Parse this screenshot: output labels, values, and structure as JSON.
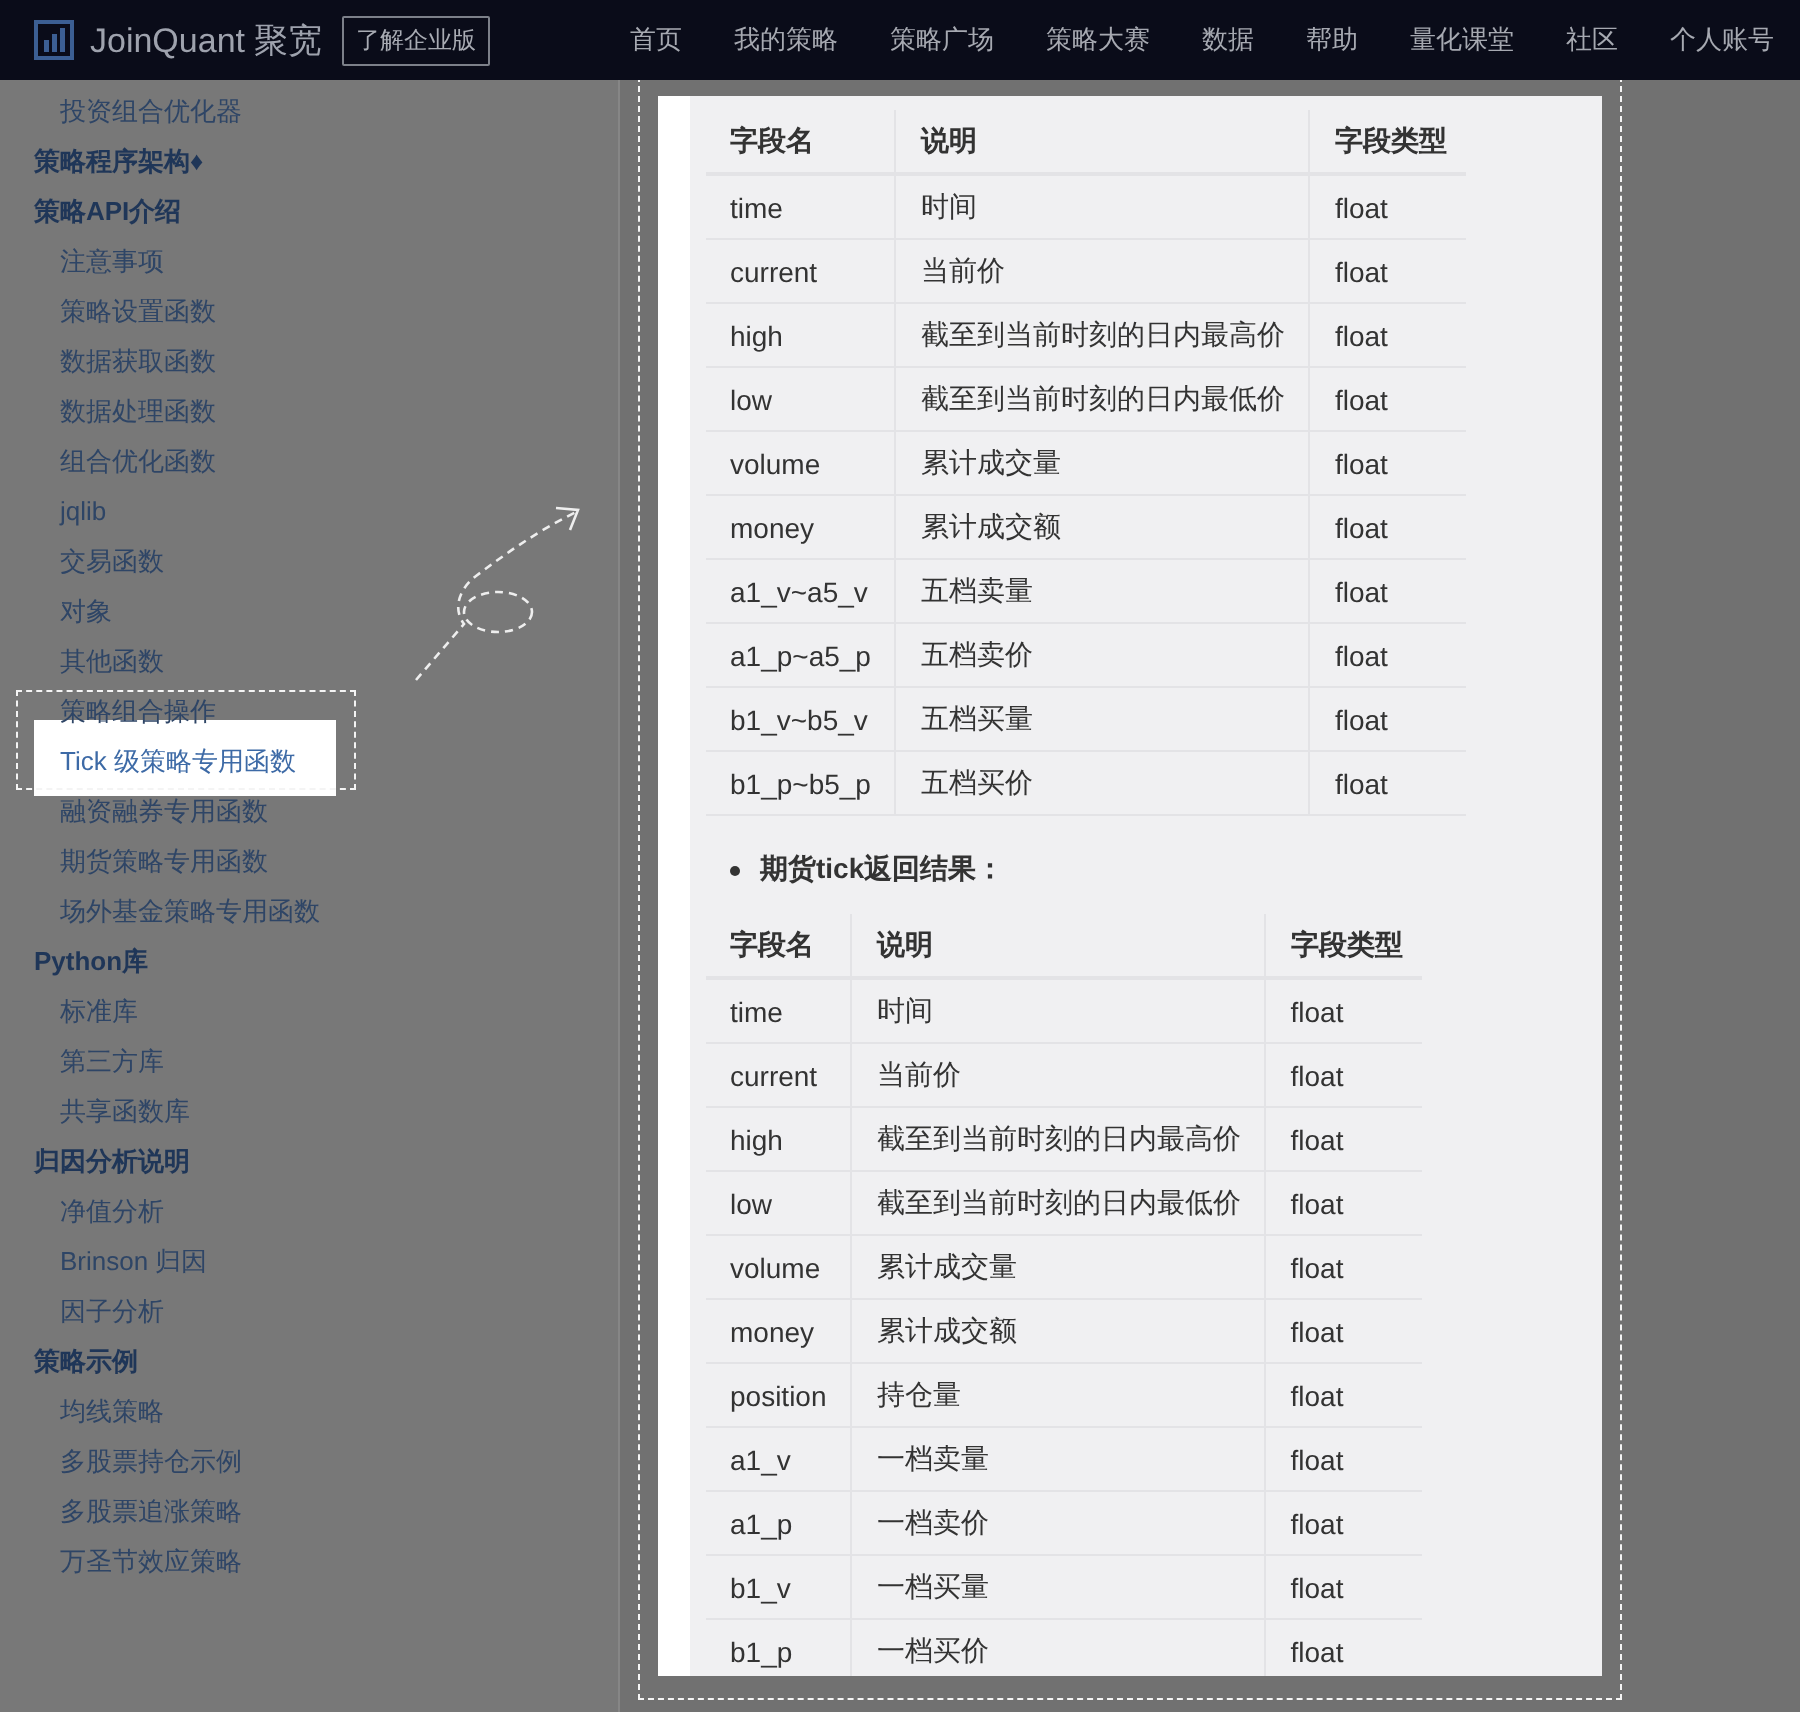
{
  "header": {
    "brand": "JoinQuant 聚宽",
    "enterprise_button": "了解企业版",
    "nav": [
      "首页",
      "我的策略",
      "策略广场",
      "策略大赛",
      "数据",
      "帮助",
      "量化课堂",
      "社区",
      "个人账号"
    ]
  },
  "sidebar": {
    "sections": [
      {
        "children": [
          {
            "label": "投资组合优化器",
            "selected": false
          }
        ]
      },
      {
        "title": "策略程序架构♦"
      },
      {
        "title": "策略API介绍",
        "children": [
          {
            "label": "注意事项",
            "selected": false
          },
          {
            "label": "策略设置函数",
            "selected": false
          },
          {
            "label": "数据获取函数",
            "selected": false
          },
          {
            "label": "数据处理函数",
            "selected": false
          },
          {
            "label": "组合优化函数",
            "selected": false
          },
          {
            "label": "jqlib",
            "selected": false
          },
          {
            "label": "交易函数",
            "selected": false
          },
          {
            "label": "对象",
            "selected": false
          },
          {
            "label": "其他函数",
            "selected": false
          },
          {
            "label": "策略组合操作",
            "selected": false
          },
          {
            "label": "Tick 级策略专用函数",
            "selected": true
          },
          {
            "label": "融资融券专用函数",
            "selected": false
          },
          {
            "label": "期货策略专用函数",
            "selected": false
          },
          {
            "label": "场外基金策略专用函数",
            "selected": false
          }
        ]
      },
      {
        "title": "Python库",
        "children": [
          {
            "label": "标准库",
            "selected": false
          },
          {
            "label": "第三方库",
            "selected": false
          },
          {
            "label": "共享函数库",
            "selected": false
          }
        ]
      },
      {
        "title": "归因分析说明",
        "children": [
          {
            "label": "净值分析",
            "selected": false
          },
          {
            "label": "Brinson 归因",
            "selected": false
          },
          {
            "label": "因子分析",
            "selected": false
          }
        ]
      },
      {
        "title": "策略示例",
        "children": [
          {
            "label": "均线策略",
            "selected": false
          },
          {
            "label": "多股票持仓示例",
            "selected": false
          },
          {
            "label": "多股票追涨策略",
            "selected": false
          },
          {
            "label": "万圣节效应策略",
            "selected": false
          }
        ]
      }
    ]
  },
  "content": {
    "stock_table": {
      "columns": [
        "字段名",
        "说明",
        "字段类型"
      ],
      "rows": [
        [
          "time",
          "时间",
          "float"
        ],
        [
          "current",
          "当前价",
          "float"
        ],
        [
          "high",
          "截至到当前时刻的日内最高价",
          "float"
        ],
        [
          "low",
          "截至到当前时刻的日内最低价",
          "float"
        ],
        [
          "volume",
          "累计成交量",
          "float"
        ],
        [
          "money",
          "累计成交额",
          "float"
        ],
        [
          "a1_v~a5_v",
          "五档卖量",
          "float"
        ],
        [
          "a1_p~a5_p",
          "五档卖价",
          "float"
        ],
        [
          "b1_v~b5_v",
          "五档买量",
          "float"
        ],
        [
          "b1_p~b5_p",
          "五档买价",
          "float"
        ]
      ]
    },
    "futures_heading": "期货tick返回结果：",
    "futures_table": {
      "columns": [
        "字段名",
        "说明",
        "字段类型"
      ],
      "rows": [
        [
          "time",
          "时间",
          "float"
        ],
        [
          "current",
          "当前价",
          "float"
        ],
        [
          "high",
          "截至到当前时刻的日内最高价",
          "float"
        ],
        [
          "low",
          "截至到当前时刻的日内最低价",
          "float"
        ],
        [
          "volume",
          "累计成交量",
          "float"
        ],
        [
          "money",
          "累计成交额",
          "float"
        ],
        [
          "position",
          "持仓量",
          "float"
        ],
        [
          "a1_v",
          "一档卖量",
          "float"
        ],
        [
          "a1_p",
          "一档卖价",
          "float"
        ],
        [
          "b1_v",
          "一档买量",
          "float"
        ],
        [
          "b1_p",
          "一档买价",
          "float"
        ]
      ]
    }
  }
}
